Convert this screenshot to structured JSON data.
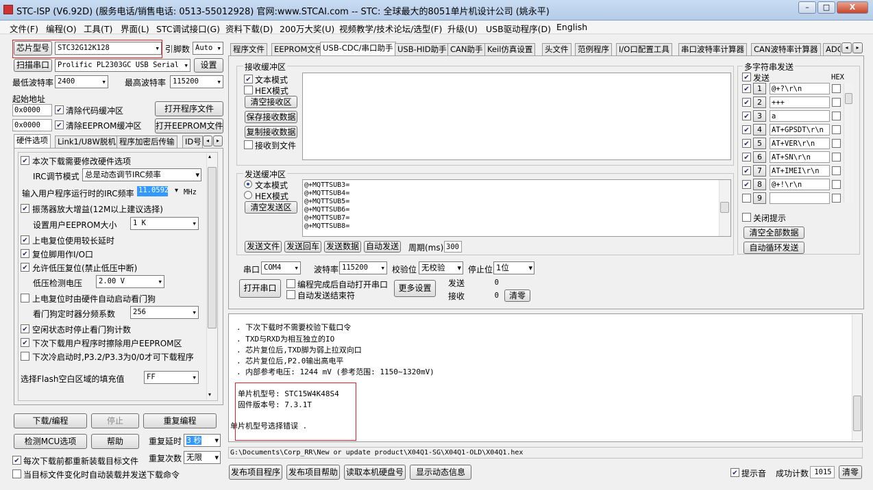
{
  "window": {
    "title": "STC-ISP (V6.92D) (服务电话/销售电话: 0513-55012928) 官网:www.STCAI.com  -- STC: 全球最大的8051单片机设计公司 (姚永平)",
    "min": "–",
    "max": "□",
    "close": "X"
  },
  "menu": [
    "文件(F)",
    "编程(O)",
    "工具(T)",
    "界面(L)",
    "STC调试接口(G)",
    "资料下载(D)",
    "200万大奖(U)",
    "视频教学/技术论坛/选型(F)",
    "升级(U)",
    "USB驱动程序(D)",
    "English"
  ],
  "left": {
    "chip_btn": "芯片型号",
    "chip_value": "STC32G12K128",
    "pin_label": "引脚数",
    "pin_value": "Auto",
    "scan_btn": "扫描串口",
    "port_value": "Prolific PL2303GC USB Serial (",
    "settings_btn": "设置",
    "min_baud_label": "最低波特率",
    "min_baud": "2400",
    "max_baud_label": "最高波特率",
    "max_baud": "115200",
    "start_addr_label": "起始地址",
    "addr1": "0x0000",
    "clear_code": "清除代码缓冲区",
    "open_prog": "打开程序文件",
    "addr2": "0x0000",
    "clear_eeprom": "清除EEPROM缓冲区",
    "open_eeprom": "打开EEPROM文件",
    "tabs": [
      "硬件选项",
      "Link1/U8W脱机",
      "程序加密后传输",
      "ID号"
    ],
    "hw": {
      "opt_modify": "本次下载需要修改硬件选项",
      "irc_mode_label": "IRC调节模式",
      "irc_mode": "总是动态调节IRC频率",
      "irc_freq_label": "输入用户程序运行时的IRC频率",
      "irc_freq": "11.0592",
      "irc_unit": "MHz",
      "osc_gain": "振荡器放大增益(12M以上建议选择)",
      "eeprom_size_label": "设置用户EEPROM大小",
      "eeprom_size": "1   K",
      "power_reset_delay": "上电复位使用较长延时",
      "reset_io": "复位脚用作I/O口",
      "lvr": "允许低压复位(禁止低压中断)",
      "lv_label": "低压检测电压",
      "lv_value": "2.00 V",
      "wdt_hw": "上电复位时由硬件自动启动看门狗",
      "wdt_div_label": "看门狗定时器分频系数",
      "wdt_div": "256",
      "idle_wdt": "空闲状态时停止看门狗计数",
      "erase_eeprom": "下次下载用户程序时擦除用户EEPROM区",
      "cold_boot": "下次冷启动时,P3.2/P3.3为0/0才可下载程序",
      "flash_fill_label": "选择Flash空白区域的填充值",
      "flash_fill": "FF"
    },
    "download_btn": "下载/编程",
    "stop_btn": "停止",
    "reprog_btn": "重复编程",
    "detect_btn": "检测MCU选项",
    "help_btn": "帮助",
    "repeat_delay_label": "重复延时",
    "repeat_delay": "3 秒",
    "repeat_count_label": "重复次数",
    "repeat_count": "无限",
    "reload_each": "每次下载前都重新装载目标文件",
    "auto_on_change": "当目标文件变化时自动装载并发送下载命令"
  },
  "tabs": [
    "程序文件",
    "EEPROM文件",
    "USB-CDC/串口助手",
    "USB-HID助手",
    "CAN助手",
    "Keil仿真设置",
    "头文件",
    "范例程序",
    "I/O口配置工具",
    "串口波特率计算器",
    "CAN波特率计算器",
    "ADC转"
  ],
  "serial": {
    "recv_title": "接收缓冲区",
    "text_mode": "文本模式",
    "hex_mode": "HEX模式",
    "clear_recv": "清空接收区",
    "save_recv": "保存接收数据",
    "copy_recv": "复制接收数据",
    "recv_to_file": "接收到文件",
    "send_title": "发送缓冲区",
    "send_text_mode": "文本模式",
    "send_hex_mode": "HEX模式",
    "clear_send": "清空发送区",
    "send_lines": [
      "@+MQTTSUB3=",
      "@+MQTTSUB4=",
      "@+MQTTSUB5=",
      "@+MQTTSUB6=",
      "@+MQTTSUB7=",
      "@+MQTTSUB8="
    ],
    "send_file": "发送文件",
    "send_enter": "发送回车",
    "send_data": "发送数据",
    "auto_send": "自动发送",
    "period_label": "周期(ms)",
    "period": "300",
    "port_label": "串口",
    "port": "COM4",
    "baud_label": "波特率",
    "baud": "115200",
    "parity_label": "校验位",
    "parity": "无校验",
    "stop_label": "停止位",
    "stop": "1位",
    "open_port": "打开串口",
    "auto_open": "编程完成后自动打开串口",
    "auto_end": "自动发送结束符",
    "more_settings": "更多设置",
    "sent_label": "发送",
    "sent": "0",
    "recv_label": "接收",
    "recv": "0",
    "clear_count": "清零"
  },
  "multi": {
    "title": "多字符串发送",
    "send_col": "发送",
    "hex_col": "HEX",
    "rows": [
      {
        "n": "1",
        "v": "@+?\\r\\n"
      },
      {
        "n": "2",
        "v": "+++"
      },
      {
        "n": "3",
        "v": "a"
      },
      {
        "n": "4",
        "v": "AT+GPSDT\\r\\n"
      },
      {
        "n": "5",
        "v": "AT+VER\\r\\n"
      },
      {
        "n": "6",
        "v": "AT+SN\\r\\n"
      },
      {
        "n": "7",
        "v": "AT+IMEI\\r\\n"
      },
      {
        "n": "8",
        "v": "@+!\\r\\n"
      },
      {
        "n": "9",
        "v": ""
      }
    ],
    "close_hint": "关闭提示",
    "clear_all": "清空全部数据",
    "auto_loop": "自动循环发送"
  },
  "log": {
    "lines": [
      ". 下次下载时不需要校验下载口令",
      ". TXD与RXD为相互独立的IO",
      ". 芯片复位后,TXD脚为弱上拉双向口",
      ". 芯片复位后,P2.0输出高电平",
      ". 内部参考电压: 1244 mV (参考范围: 1150~1320mV)"
    ],
    "mcu_model": "单片机型号: STC15W4K48S4",
    "firmware": "固件版本号: 7.3.1T",
    "error": "单片机型号选择错误 ."
  },
  "path": "G:\\Documents\\Corp_RR\\New or update product\\X04Q1-SG\\X04Q1-OLD\\X04Q1.hex",
  "bottom": {
    "publish_prog": "发布项目程序",
    "publish_help": "发布项目帮助",
    "read_disk": "读取本机硬盘号",
    "show_anim": "显示动态信息",
    "sound": "提示音",
    "success_label": "成功计数",
    "success": "1015",
    "clear": "清零"
  }
}
